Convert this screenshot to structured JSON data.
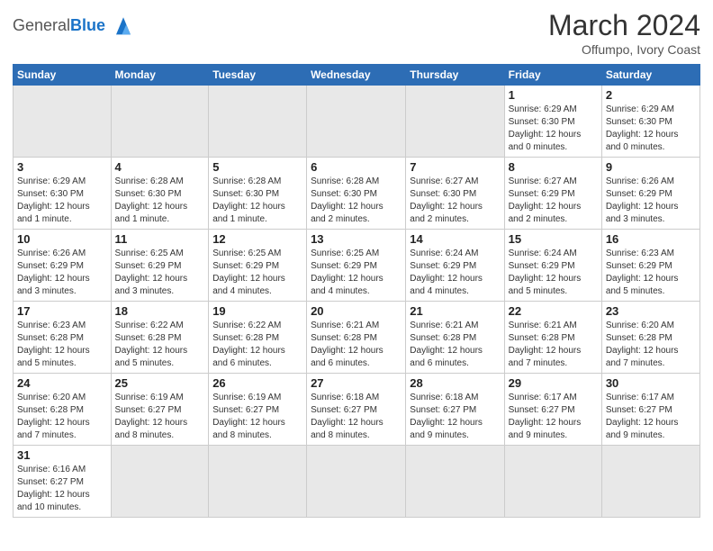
{
  "header": {
    "logo_general": "General",
    "logo_blue": "Blue",
    "month_title": "March 2024",
    "subtitle": "Offumpo, Ivory Coast"
  },
  "weekdays": [
    "Sunday",
    "Monday",
    "Tuesday",
    "Wednesday",
    "Thursday",
    "Friday",
    "Saturday"
  ],
  "weeks": [
    [
      {
        "day": "",
        "info": ""
      },
      {
        "day": "",
        "info": ""
      },
      {
        "day": "",
        "info": ""
      },
      {
        "day": "",
        "info": ""
      },
      {
        "day": "",
        "info": ""
      },
      {
        "day": "1",
        "info": "Sunrise: 6:29 AM\nSunset: 6:30 PM\nDaylight: 12 hours\nand 0 minutes."
      },
      {
        "day": "2",
        "info": "Sunrise: 6:29 AM\nSunset: 6:30 PM\nDaylight: 12 hours\nand 0 minutes."
      }
    ],
    [
      {
        "day": "3",
        "info": "Sunrise: 6:29 AM\nSunset: 6:30 PM\nDaylight: 12 hours\nand 1 minute."
      },
      {
        "day": "4",
        "info": "Sunrise: 6:28 AM\nSunset: 6:30 PM\nDaylight: 12 hours\nand 1 minute."
      },
      {
        "day": "5",
        "info": "Sunrise: 6:28 AM\nSunset: 6:30 PM\nDaylight: 12 hours\nand 1 minute."
      },
      {
        "day": "6",
        "info": "Sunrise: 6:28 AM\nSunset: 6:30 PM\nDaylight: 12 hours\nand 2 minutes."
      },
      {
        "day": "7",
        "info": "Sunrise: 6:27 AM\nSunset: 6:30 PM\nDaylight: 12 hours\nand 2 minutes."
      },
      {
        "day": "8",
        "info": "Sunrise: 6:27 AM\nSunset: 6:29 PM\nDaylight: 12 hours\nand 2 minutes."
      },
      {
        "day": "9",
        "info": "Sunrise: 6:26 AM\nSunset: 6:29 PM\nDaylight: 12 hours\nand 3 minutes."
      }
    ],
    [
      {
        "day": "10",
        "info": "Sunrise: 6:26 AM\nSunset: 6:29 PM\nDaylight: 12 hours\nand 3 minutes."
      },
      {
        "day": "11",
        "info": "Sunrise: 6:25 AM\nSunset: 6:29 PM\nDaylight: 12 hours\nand 3 minutes."
      },
      {
        "day": "12",
        "info": "Sunrise: 6:25 AM\nSunset: 6:29 PM\nDaylight: 12 hours\nand 4 minutes."
      },
      {
        "day": "13",
        "info": "Sunrise: 6:25 AM\nSunset: 6:29 PM\nDaylight: 12 hours\nand 4 minutes."
      },
      {
        "day": "14",
        "info": "Sunrise: 6:24 AM\nSunset: 6:29 PM\nDaylight: 12 hours\nand 4 minutes."
      },
      {
        "day": "15",
        "info": "Sunrise: 6:24 AM\nSunset: 6:29 PM\nDaylight: 12 hours\nand 5 minutes."
      },
      {
        "day": "16",
        "info": "Sunrise: 6:23 AM\nSunset: 6:29 PM\nDaylight: 12 hours\nand 5 minutes."
      }
    ],
    [
      {
        "day": "17",
        "info": "Sunrise: 6:23 AM\nSunset: 6:28 PM\nDaylight: 12 hours\nand 5 minutes."
      },
      {
        "day": "18",
        "info": "Sunrise: 6:22 AM\nSunset: 6:28 PM\nDaylight: 12 hours\nand 5 minutes."
      },
      {
        "day": "19",
        "info": "Sunrise: 6:22 AM\nSunset: 6:28 PM\nDaylight: 12 hours\nand 6 minutes."
      },
      {
        "day": "20",
        "info": "Sunrise: 6:21 AM\nSunset: 6:28 PM\nDaylight: 12 hours\nand 6 minutes."
      },
      {
        "day": "21",
        "info": "Sunrise: 6:21 AM\nSunset: 6:28 PM\nDaylight: 12 hours\nand 6 minutes."
      },
      {
        "day": "22",
        "info": "Sunrise: 6:21 AM\nSunset: 6:28 PM\nDaylight: 12 hours\nand 7 minutes."
      },
      {
        "day": "23",
        "info": "Sunrise: 6:20 AM\nSunset: 6:28 PM\nDaylight: 12 hours\nand 7 minutes."
      }
    ],
    [
      {
        "day": "24",
        "info": "Sunrise: 6:20 AM\nSunset: 6:28 PM\nDaylight: 12 hours\nand 7 minutes."
      },
      {
        "day": "25",
        "info": "Sunrise: 6:19 AM\nSunset: 6:27 PM\nDaylight: 12 hours\nand 8 minutes."
      },
      {
        "day": "26",
        "info": "Sunrise: 6:19 AM\nSunset: 6:27 PM\nDaylight: 12 hours\nand 8 minutes."
      },
      {
        "day": "27",
        "info": "Sunrise: 6:18 AM\nSunset: 6:27 PM\nDaylight: 12 hours\nand 8 minutes."
      },
      {
        "day": "28",
        "info": "Sunrise: 6:18 AM\nSunset: 6:27 PM\nDaylight: 12 hours\nand 9 minutes."
      },
      {
        "day": "29",
        "info": "Sunrise: 6:17 AM\nSunset: 6:27 PM\nDaylight: 12 hours\nand 9 minutes."
      },
      {
        "day": "30",
        "info": "Sunrise: 6:17 AM\nSunset: 6:27 PM\nDaylight: 12 hours\nand 9 minutes."
      }
    ],
    [
      {
        "day": "31",
        "info": "Sunrise: 6:16 AM\nSunset: 6:27 PM\nDaylight: 12 hours\nand 10 minutes."
      },
      {
        "day": "",
        "info": ""
      },
      {
        "day": "",
        "info": ""
      },
      {
        "day": "",
        "info": ""
      },
      {
        "day": "",
        "info": ""
      },
      {
        "day": "",
        "info": ""
      },
      {
        "day": "",
        "info": ""
      }
    ]
  ]
}
